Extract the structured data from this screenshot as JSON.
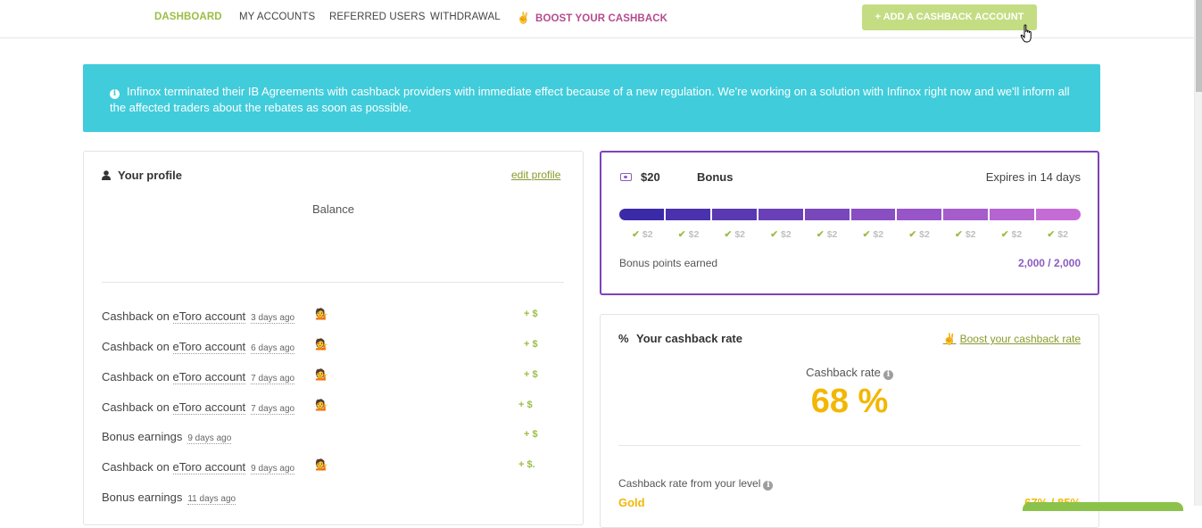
{
  "nav": {
    "items": [
      {
        "label": "DASHBOARD",
        "state": "active"
      },
      {
        "label": "MY ACCOUNTS"
      },
      {
        "label": "REFERRED USERS"
      },
      {
        "label": "WITHDRAWAL"
      }
    ],
    "boost_label": "BOOST YOUR CASHBACK",
    "add_account_label": "+ ADD A CASHBACK ACCOUNT"
  },
  "alert": {
    "text": "Infinox terminated their IB Agreements with cashback providers with immediate effect because of a new regulation. We're working on a solution with Infinox right now and we'll inform all the affected traders about the rebates as soon as possible."
  },
  "profile": {
    "title": "Your profile",
    "edit_label": "edit profile",
    "balance_label": "Balance",
    "transactions": [
      {
        "prefix": "Cashback on ",
        "account": "eToro account",
        "ago": "3 days ago",
        "amount": "+ $",
        "emoji": true
      },
      {
        "prefix": "Cashback on ",
        "account": "eToro account",
        "ago": "6 days ago",
        "amount": "+ $",
        "emoji": true
      },
      {
        "prefix": "Cashback on ",
        "account": "eToro account",
        "ago": "7 days ago",
        "amount": "+ $",
        "emoji": true
      },
      {
        "prefix": "Cashback on ",
        "account": "eToro account",
        "ago": "7 days ago",
        "amount": "+ $",
        "emoji": true
      },
      {
        "prefix": "Bonus earnings",
        "account": "",
        "ago": "9 days ago",
        "amount": "+ $",
        "emoji": false
      },
      {
        "prefix": "Cashback on ",
        "account": "eToro account",
        "ago": "9 days ago",
        "amount": "+ $.",
        "emoji": true
      },
      {
        "prefix": "Bonus earnings",
        "account": "",
        "ago": "11 days ago",
        "amount": "",
        "emoji": false
      }
    ]
  },
  "bonus": {
    "amount": "$20",
    "label": "Bonus",
    "expires": "Expires in 14 days",
    "milestones": [
      "$2",
      "$2",
      "$2",
      "$2",
      "$2",
      "$2",
      "$2",
      "$2",
      "$2",
      "$2"
    ],
    "progress": 1.0,
    "points_label": "Bonus points earned",
    "points_value": "2,000 / 2,000",
    "gradient": [
      "#3b2aa8",
      "#c56bd6"
    ]
  },
  "rate": {
    "title": "Your cashback rate",
    "boost_label": "Boost your cashback rate",
    "rate_label": "Cashback rate",
    "rate_value": "68 %",
    "level_label": "Cashback rate from your level",
    "level_name": "Gold",
    "level_range": "67% / 85%"
  },
  "colors": {
    "accent_green": "#9bbe45",
    "alert_bg": "#40ccdb",
    "bonus_border": "#7e43b8",
    "rate_yellow": "#f2b705"
  }
}
